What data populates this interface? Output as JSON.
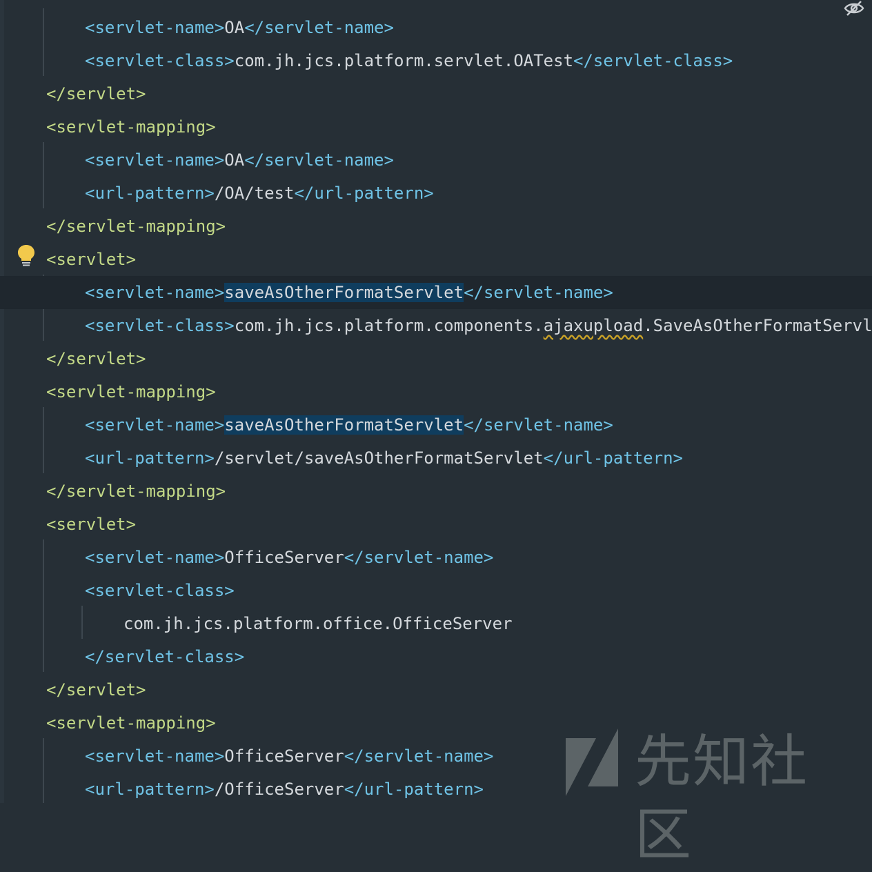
{
  "lines": [
    {
      "open": "<servlet-name>",
      "text": "OA",
      "close": "</servlet-name>"
    },
    {
      "open": "<servlet-class>",
      "text": "com.jh.jcs.platform.servlet.OATest",
      "close": "</servlet-class>"
    },
    {
      "tag": "</servlet>"
    },
    {
      "tag": "<servlet-mapping>"
    },
    {
      "open": "<servlet-name>",
      "text": "OA",
      "close": "</servlet-name>"
    },
    {
      "open": "<url-pattern>",
      "text": "/OA/test",
      "close": "</url-pattern>"
    },
    {
      "tag": "</servlet-mapping>"
    },
    {
      "tag": "<servlet>"
    },
    {
      "open": "<servlet-name>",
      "text": "saveAsOtherFormatServlet",
      "close": "</servlet-name>"
    },
    {
      "open": "<servlet-class>",
      "text_a": "com.jh.jcs.platform.components.",
      "text_b": "ajaxupload",
      "text_c": ".SaveAsOtherFormatServlet",
      "close": "<"
    },
    {
      "tag": "</servlet>"
    },
    {
      "tag": "<servlet-mapping>"
    },
    {
      "open": "<servlet-name>",
      "text": "saveAsOtherFormatServlet",
      "close": "</servlet-name>"
    },
    {
      "open": "<url-pattern>",
      "text": "/servlet/saveAsOtherFormatServlet",
      "close": "</url-pattern>"
    },
    {
      "tag": "</servlet-mapping>"
    },
    {
      "tag": "<servlet>"
    },
    {
      "open": "<servlet-name>",
      "text": "OfficeServer",
      "close": "</servlet-name>"
    },
    {
      "tag": "<servlet-class>"
    },
    {
      "text": "com.jh.jcs.platform.office.OfficeServer"
    },
    {
      "tag": "</servlet-class>"
    },
    {
      "tag": "</servlet>"
    },
    {
      "tag": "<servlet-mapping>"
    },
    {
      "open": "<servlet-name>",
      "text": "OfficeServer",
      "close": "</servlet-name>"
    },
    {
      "open": "<url-pattern>",
      "text": "/OfficeServer",
      "close": "</url-pattern>"
    }
  ],
  "watermark": {
    "text": "先知社区"
  },
  "icons": {
    "intention": "lightbulb-icon",
    "reader_mode": "eye-crossed-icon"
  },
  "colors": {
    "background": "#262f36",
    "current_line": "#1f272e",
    "outer_tag": "#c3d987",
    "inner_tag": "#6fc3e6",
    "text": "#d4d8dc",
    "highlight": "#0f3d5e"
  }
}
